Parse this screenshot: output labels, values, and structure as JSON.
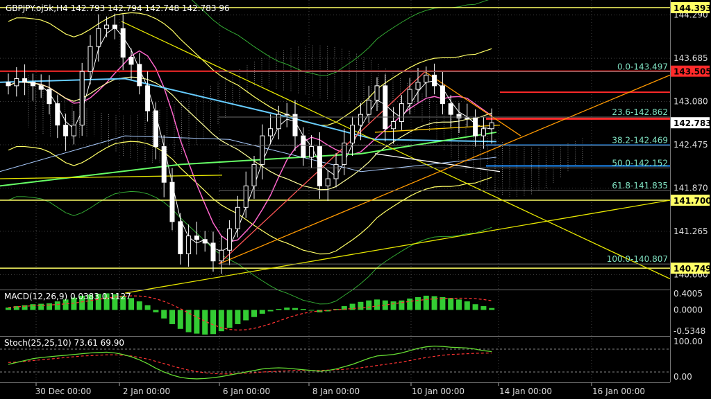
{
  "header": {
    "symbol": "GBPJPY.oj5k",
    "timeframe": "H4",
    "ohlc": "142.793 142.794 142.748 142.783 96"
  },
  "price_axis": {
    "ticks": [
      "144.290",
      "143.685",
      "143.080",
      "142.475",
      "141.870",
      "141.265",
      "140.660"
    ],
    "labels": [
      {
        "text": "144.393",
        "price": 144.393,
        "bg": "#ffff66",
        "fg": "#000000"
      },
      {
        "text": "143.505",
        "price": 143.505,
        "bg": "#ff2a2a",
        "fg": "#000000"
      },
      {
        "text": "142.783",
        "price": 142.783,
        "bg": "#ffffff",
        "fg": "#000000"
      },
      {
        "text": "141.700",
        "price": 141.7,
        "bg": "#ffff66",
        "fg": "#000000"
      },
      {
        "text": "140.749",
        "price": 140.749,
        "bg": "#ffff66",
        "fg": "#000000"
      }
    ]
  },
  "fibonacci": [
    {
      "text": "0.0-143.497",
      "price": 143.497
    },
    {
      "text": "23.6-142.862",
      "price": 142.862
    },
    {
      "text": "38.2-142.469",
      "price": 142.469
    },
    {
      "text": "50.0-142.152",
      "price": 142.152
    },
    {
      "text": "61.8-141.835",
      "price": 141.835
    },
    {
      "text": "100.0-140.807",
      "price": 140.807
    }
  ],
  "macd": {
    "label": "MACD(12,26,9) 0.0383 0.1127",
    "ticks": [
      "0.4005",
      "0.0000",
      "-0.5348"
    ]
  },
  "stoch": {
    "label": "Stoch(25,25,10) 73.61 69.90",
    "ticks": [
      "100.00",
      "0.00"
    ]
  },
  "time_axis": [
    "30 Dec 00:00",
    "2 Jan 00:00",
    "6 Jan 00:00",
    "8 Jan 00:00",
    "10 Jan 00:00",
    "14 Jan 00:00",
    "16 Jan 00:00"
  ],
  "colors": {
    "bull": "#000000",
    "bear": "#ffffff",
    "grid": "#444444",
    "horizontal_lines": "#ffff66",
    "resistance": "#ff2a2a",
    "support": "#1e90ff",
    "ma_cyan": "#66ccff",
    "ma_green": "#66ff66",
    "ma_pink": "#ff66cc",
    "bollinger": "#ffff66",
    "envelope": "#33aa33",
    "macd_hist": "#33cc33",
    "macd_signal": "#ff3333"
  },
  "chart_data": {
    "type": "candlestick",
    "symbol": "GBPJPY.oj5k",
    "timeframe": "H4",
    "x_labels": [
      "30 Dec 00:00",
      "2 Jan 00:00",
      "6 Jan 00:00",
      "8 Jan 00:00",
      "10 Jan 00:00",
      "14 Jan 00:00",
      "16 Jan 00:00"
    ],
    "ylim": [
      140.45,
      144.5
    ],
    "close_values": [
      143.3,
      143.4,
      143.35,
      143.3,
      143.25,
      143.05,
      142.75,
      142.6,
      142.75,
      143.5,
      143.85,
      144.1,
      144.15,
      144.1,
      143.7,
      143.6,
      143.3,
      142.95,
      142.45,
      141.95,
      141.4,
      140.95,
      141.2,
      141.15,
      141.1,
      140.85,
      141.0,
      141.3,
      141.6,
      141.9,
      142.2,
      142.6,
      142.7,
      142.9,
      142.9,
      142.6,
      142.3,
      142.45,
      141.9,
      142.0,
      142.2,
      142.5,
      142.75,
      142.9,
      143.1,
      143.3,
      142.7,
      142.8,
      143.05,
      143.25,
      143.35,
      143.45,
      143.3,
      143.05,
      142.9,
      142.85,
      142.85,
      142.6,
      142.7,
      142.783
    ],
    "horizontal_lines": [
      144.393,
      143.505,
      141.7,
      140.749
    ],
    "fibonacci_levels": [
      {
        "level": "0.0",
        "price": 143.497
      },
      {
        "level": "23.6",
        "price": 142.862
      },
      {
        "level": "38.2",
        "price": 142.469
      },
      {
        "level": "50.0",
        "price": 142.152
      },
      {
        "level": "61.8",
        "price": 141.835
      },
      {
        "level": "100.0",
        "price": 140.807
      }
    ],
    "macd": {
      "params": "12,26,9",
      "main": 0.0383,
      "signal": 0.1127,
      "ylim": [
        -0.5348,
        0.4005
      ],
      "hist": [
        0.05,
        0.08,
        0.1,
        0.12,
        0.13,
        0.14,
        0.18,
        0.22,
        0.26,
        0.3,
        0.32,
        0.34,
        0.35,
        0.33,
        0.3,
        0.25,
        0.18,
        0.1,
        -0.05,
        -0.18,
        -0.3,
        -0.4,
        -0.47,
        -0.5,
        -0.52,
        -0.51,
        -0.45,
        -0.38,
        -0.3,
        -0.22,
        -0.15,
        -0.08,
        -0.03,
        0.02,
        0.05,
        0.04,
        0.02,
        -0.01,
        -0.05,
        -0.03,
        0.02,
        0.08,
        0.13,
        0.17,
        0.2,
        0.22,
        0.2,
        0.18,
        0.2,
        0.24,
        0.27,
        0.3,
        0.29,
        0.27,
        0.25,
        0.22,
        0.18,
        0.12,
        0.08,
        0.04
      ]
    },
    "stochastic": {
      "params": "25,25,10",
      "main": 73.61,
      "signal": 69.9,
      "ylim": [
        0,
        100
      ],
      "main_values": [
        40,
        45,
        50,
        55,
        58,
        60,
        62,
        64,
        66,
        68,
        70,
        71,
        72,
        70,
        66,
        60,
        52,
        42,
        30,
        20,
        12,
        6,
        3,
        2,
        3,
        5,
        8,
        12,
        16,
        20,
        24,
        28,
        30,
        31,
        30,
        28,
        26,
        24,
        22,
        24,
        28,
        34,
        40,
        48,
        56,
        62,
        64,
        66,
        70,
        76,
        82,
        86,
        88,
        87,
        85,
        84,
        83,
        80,
        76,
        73.61
      ],
      "signal_values": [
        45,
        46,
        48,
        50,
        52,
        54,
        56,
        58,
        60,
        62,
        63,
        64,
        65,
        65,
        64,
        62,
        58,
        54,
        48,
        42,
        36,
        30,
        25,
        21,
        18,
        16,
        15,
        15,
        16,
        17,
        18,
        20,
        21,
        22,
        23,
        24,
        24,
        24,
        24,
        25,
        26,
        27,
        29,
        31,
        34,
        37,
        40,
        43,
        46,
        50,
        54,
        58,
        61,
        64,
        66,
        67,
        68,
        69,
        69.5,
        69.9
      ]
    }
  }
}
